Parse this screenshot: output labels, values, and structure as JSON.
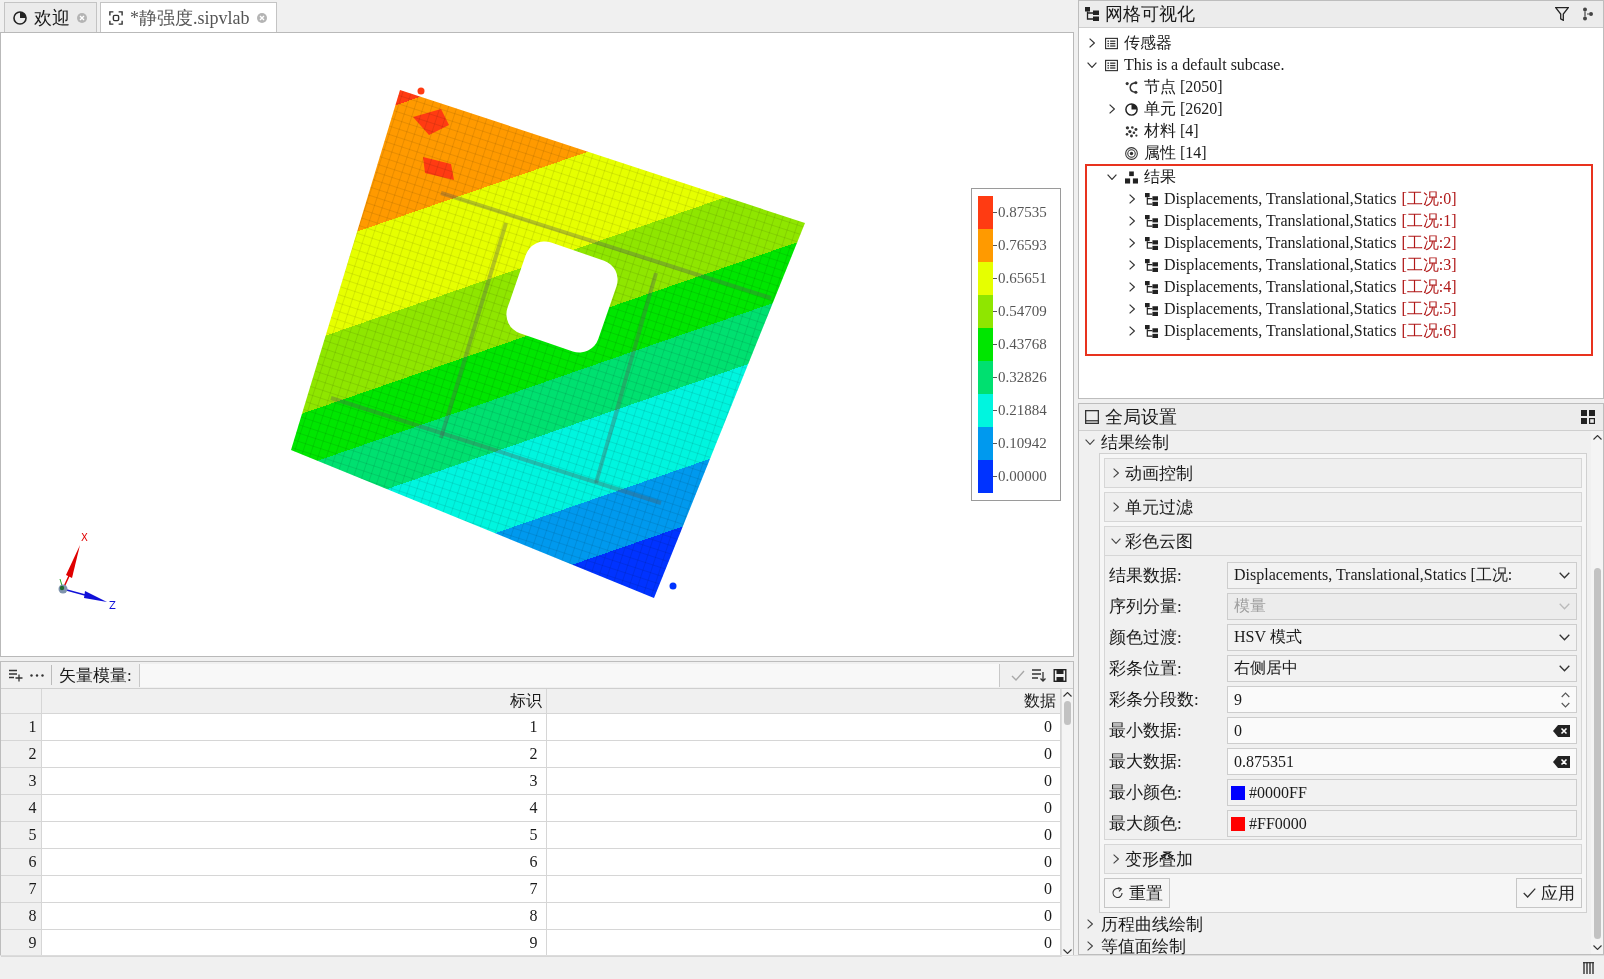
{
  "editor": {
    "tabs": [
      {
        "kind": "welcome",
        "label": "欢迎",
        "selected": false
      },
      {
        "kind": "model",
        "label": "*静强度.sipvlab",
        "selected": true
      }
    ],
    "viewport": {
      "legend": [
        {
          "label": "0.87535",
          "color": "#ff3b12"
        },
        {
          "label": "0.76593",
          "color": "#ff9a00"
        },
        {
          "label": "0.65651",
          "color": "#e6ff00"
        },
        {
          "label": "0.54709",
          "color": "#8fe600"
        },
        {
          "label": "0.43768",
          "color": "#00e600"
        },
        {
          "label": "0.32826",
          "color": "#00e070"
        },
        {
          "label": "0.21884",
          "color": "#00f5df"
        },
        {
          "label": "0.10942",
          "color": "#0099ee"
        },
        {
          "label": "0.00000",
          "color": "#0033ff"
        }
      ],
      "axes": [
        {
          "kind": "x",
          "label": "X"
        },
        {
          "kind": "z",
          "label": "Z"
        }
      ]
    }
  },
  "data_table": {
    "filter_label": "矢量模量:",
    "columns": [
      "标识",
      "数据"
    ],
    "rows": [
      {
        "number": "1",
        "id": "1",
        "value": "0"
      },
      {
        "number": "2",
        "id": "2",
        "value": "0"
      },
      {
        "number": "3",
        "id": "3",
        "value": "0"
      },
      {
        "number": "4",
        "id": "4",
        "value": "0"
      },
      {
        "number": "5",
        "id": "5",
        "value": "0"
      },
      {
        "number": "6",
        "id": "6",
        "value": "0"
      },
      {
        "number": "7",
        "id": "7",
        "value": "0"
      },
      {
        "number": "8",
        "id": "8",
        "value": "0"
      },
      {
        "number": "9",
        "id": "9",
        "value": "0"
      }
    ]
  },
  "mesh_tree": {
    "title": "网格可视化",
    "items": [
      {
        "kind": "group",
        "label": "传感器",
        "expandable": true,
        "expanded": false,
        "highlighted": false
      },
      {
        "kind": "group",
        "label": "This is a default subcase.",
        "expandable": true,
        "expanded": true,
        "highlighted": false,
        "children": [
          {
            "kind": "nodes",
            "label": "节点 [2050]",
            "expandable": false,
            "expanded": false,
            "highlighted": false
          },
          {
            "kind": "elements",
            "label": "单元 [2620]",
            "expandable": true,
            "expanded": false,
            "highlighted": false
          },
          {
            "kind": "materials",
            "label": "材料 [4]",
            "expandable": false,
            "expanded": false,
            "highlighted": false
          },
          {
            "kind": "properties",
            "label": "属性 [14]",
            "expandable": false,
            "expanded": false,
            "highlighted": false
          },
          {
            "kind": "results",
            "label": "结果",
            "expandable": true,
            "expanded": true,
            "highlighted": true,
            "children": [
              {
                "kind": "dataset",
                "label": "Displacements, Translational,Statics",
                "tag": "[工况:0]",
                "expandable": true,
                "expanded": false,
                "highlighted": false
              },
              {
                "kind": "dataset",
                "label": "Displacements, Translational,Statics",
                "tag": "[工况:1]",
                "expandable": true,
                "expanded": false,
                "highlighted": false
              },
              {
                "kind": "dataset",
                "label": "Displacements, Translational,Statics",
                "tag": "[工况:2]",
                "expandable": true,
                "expanded": false,
                "highlighted": false
              },
              {
                "kind": "dataset",
                "label": "Displacements, Translational,Statics",
                "tag": "[工况:3]",
                "expandable": true,
                "expanded": false,
                "highlighted": false
              },
              {
                "kind": "dataset",
                "label": "Displacements, Translational,Statics",
                "tag": "[工况:4]",
                "expandable": true,
                "expanded": false,
                "highlighted": false
              },
              {
                "kind": "dataset",
                "label": "Displacements, Translational,Statics",
                "tag": "[工况:5]",
                "expandable": true,
                "expanded": false,
                "highlighted": false
              },
              {
                "kind": "dataset",
                "label": "Displacements, Translational,Statics",
                "tag": "[工况:6]",
                "expandable": true,
                "expanded": false,
                "highlighted": false
              }
            ]
          }
        ]
      }
    ]
  },
  "global_settings": {
    "title": "全局设置",
    "sections": [
      {
        "label": "结果绘制",
        "expanded": true,
        "groups": [
          {
            "label": "动画控制",
            "expanded": false
          },
          {
            "label": "单元过滤",
            "expanded": false
          },
          {
            "label": "彩色云图",
            "expanded": true,
            "fields": [
              {
                "kind": "combo",
                "label": "结果数据:",
                "value": "Displacements, Translational,Statics [工况:",
                "disabled": false
              },
              {
                "kind": "combo",
                "label": "序列分量:",
                "value": "模量",
                "disabled": true
              },
              {
                "kind": "combo",
                "label": "颜色过渡:",
                "value": "HSV 模式",
                "disabled": false
              },
              {
                "kind": "combo",
                "label": "彩条位置:",
                "value": "右侧居中",
                "disabled": false
              },
              {
                "kind": "spin",
                "label": "彩条分段数:",
                "value": "9",
                "disabled": false
              },
              {
                "kind": "clearable",
                "label": "最小数据:",
                "value": "0",
                "disabled": false
              },
              {
                "kind": "clearable",
                "label": "最大数据:",
                "value": "0.875351",
                "disabled": false
              },
              {
                "kind": "color",
                "label": "最小颜色:",
                "value": "#0000FF",
                "color": "#0000ff",
                "disabled": false
              },
              {
                "kind": "color",
                "label": "最大颜色:",
                "value": "#FF0000",
                "color": "#ff0000",
                "disabled": false
              }
            ]
          },
          {
            "label": "变形叠加",
            "expanded": false
          }
        ],
        "buttons": [
          {
            "kind": "reset",
            "label": "重置"
          },
          {
            "kind": "apply",
            "label": "应用"
          }
        ]
      },
      {
        "label": "历程曲线绘制",
        "expanded": false
      },
      {
        "label": "等值面绘制",
        "expanded": false
      }
    ]
  }
}
